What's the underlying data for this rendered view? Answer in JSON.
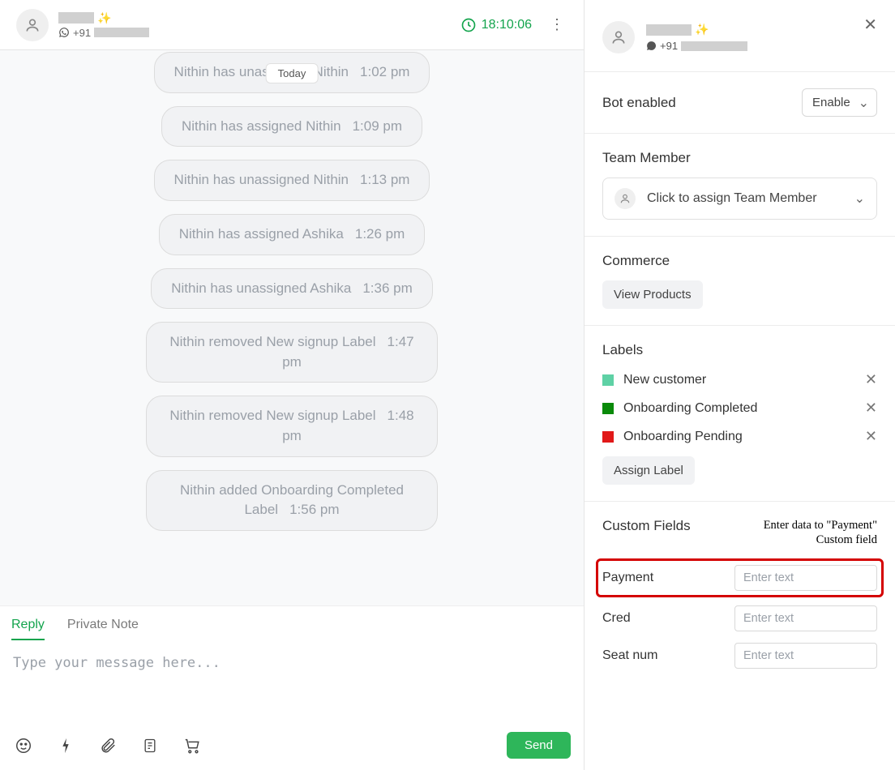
{
  "header": {
    "phone_prefix": "+91",
    "time": "18:10:06"
  },
  "chat": {
    "date_label": "Today",
    "system_messages": [
      {
        "text": "Nithin has unassigned Nithin",
        "time": "1:02 pm",
        "clipped": true
      },
      {
        "text": "Nithin has assigned Nithin",
        "time": "1:09 pm"
      },
      {
        "text": "Nithin has unassigned Nithin",
        "time": "1:13 pm"
      },
      {
        "text": "Nithin has assigned Ashika",
        "time": "1:26 pm"
      },
      {
        "text": "Nithin has unassigned Ashika",
        "time": "1:36 pm"
      },
      {
        "text": "Nithin removed New signup Label",
        "time": "1:47 pm"
      },
      {
        "text": "Nithin removed New signup Label",
        "time": "1:48 pm"
      },
      {
        "text": "Nithin added Onboarding Completed Label",
        "time": "1:56 pm"
      }
    ]
  },
  "composer": {
    "tab_reply": "Reply",
    "tab_note": "Private Note",
    "placeholder": "Type your message here...",
    "send_label": "Send"
  },
  "panel": {
    "profile_phone_prefix": "+91",
    "bot_label": "Bot enabled",
    "bot_select": "Enable",
    "team_title": "Team Member",
    "assign_placeholder": "Click to assign Team Member",
    "commerce_title": "Commerce",
    "view_products": "View Products",
    "labels_title": "Labels",
    "labels": [
      {
        "name": "New customer",
        "color": "#5ed1a5"
      },
      {
        "name": "Onboarding Completed",
        "color": "#0a8a0a"
      },
      {
        "name": "Onboarding Pending",
        "color": "#e11919"
      }
    ],
    "assign_label": "Assign Label",
    "cf_title": "Custom Fields",
    "cf_note": "Enter data to \"Payment\" Custom field",
    "cf_placeholder": "Enter text",
    "custom_fields": [
      {
        "label": "Payment",
        "highlight": true
      },
      {
        "label": "Cred"
      },
      {
        "label": "Seat num"
      }
    ]
  }
}
